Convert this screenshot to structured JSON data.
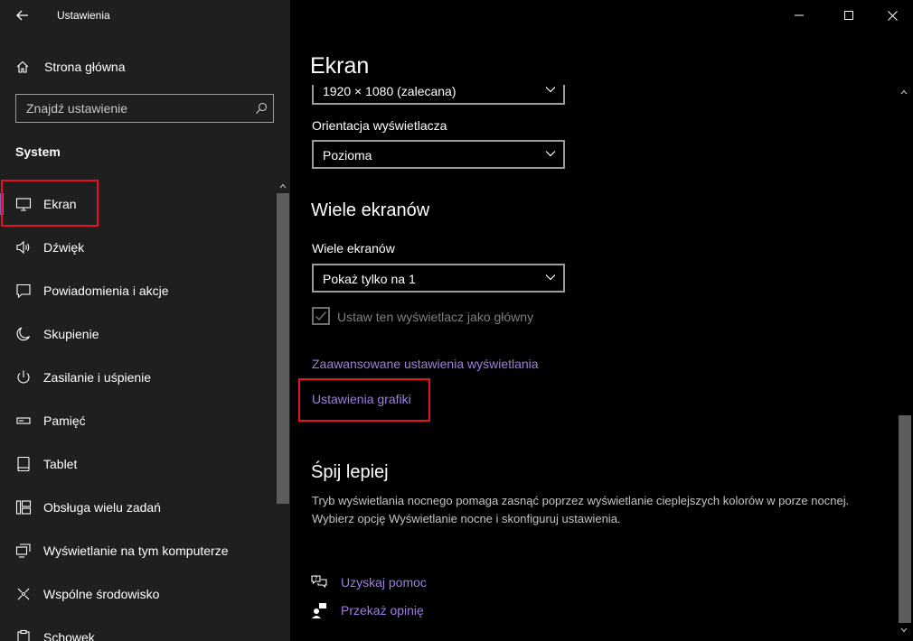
{
  "window": {
    "title": "Ustawienia",
    "controls": [
      "minimize",
      "maximize",
      "close"
    ]
  },
  "sidebar": {
    "home_label": "Strona główna",
    "search_placeholder": "Znajdź ustawienie",
    "section_label": "System",
    "items": [
      {
        "label": "Ekran",
        "icon": "monitor-icon",
        "active": true
      },
      {
        "label": "Dźwięk",
        "icon": "speaker-icon"
      },
      {
        "label": "Powiadomienia i akcje",
        "icon": "notification-icon"
      },
      {
        "label": "Skupienie",
        "icon": "moon-icon"
      },
      {
        "label": "Zasilanie i uśpienie",
        "icon": "power-icon"
      },
      {
        "label": "Pamięć",
        "icon": "storage-icon"
      },
      {
        "label": "Tablet",
        "icon": "tablet-icon"
      },
      {
        "label": "Obsługa wielu zadań",
        "icon": "multitasking-icon"
      },
      {
        "label": "Wyświetlanie na tym komputerze",
        "icon": "project-icon"
      },
      {
        "label": "Wspólne środowisko",
        "icon": "shared-experiences-icon"
      },
      {
        "label": "Schowek",
        "icon": "clipboard-icon"
      }
    ]
  },
  "main": {
    "title": "Ekran",
    "resolution_value": "1920 × 1080 (zalecana)",
    "orientation": {
      "label": "Orientacja wyświetlacza",
      "value": "Pozioma"
    },
    "multiple_displays": {
      "heading": "Wiele ekranów",
      "label": "Wiele ekranów",
      "value": "Pokaż tylko na 1",
      "checkbox_label": "Ustaw ten wyświetlacz jako główny",
      "checkbox_checked": true
    },
    "links": {
      "advanced": "Zaawansowane ustawienia wyświetlania",
      "graphics": "Ustawienia grafiki"
    },
    "sleep_better": {
      "heading": "Śpij lepiej",
      "description": "Tryb wyświetlania nocnego pomaga zasnąć poprzez wyświetlanie cieplejszych kolorów w porze nocnej. Wybierz opcję Wyświetlanie nocne i skonfiguruj ustawienia."
    },
    "help": {
      "get_help": "Uzyskaj pomoc",
      "feedback": "Przekaż opinię"
    }
  },
  "colors": {
    "accent": "#7e5cc4",
    "link": "#9d7fe0",
    "highlight": "#e81123",
    "sidebar_bg": "#1f1f1f",
    "content_bg": "#000000"
  }
}
